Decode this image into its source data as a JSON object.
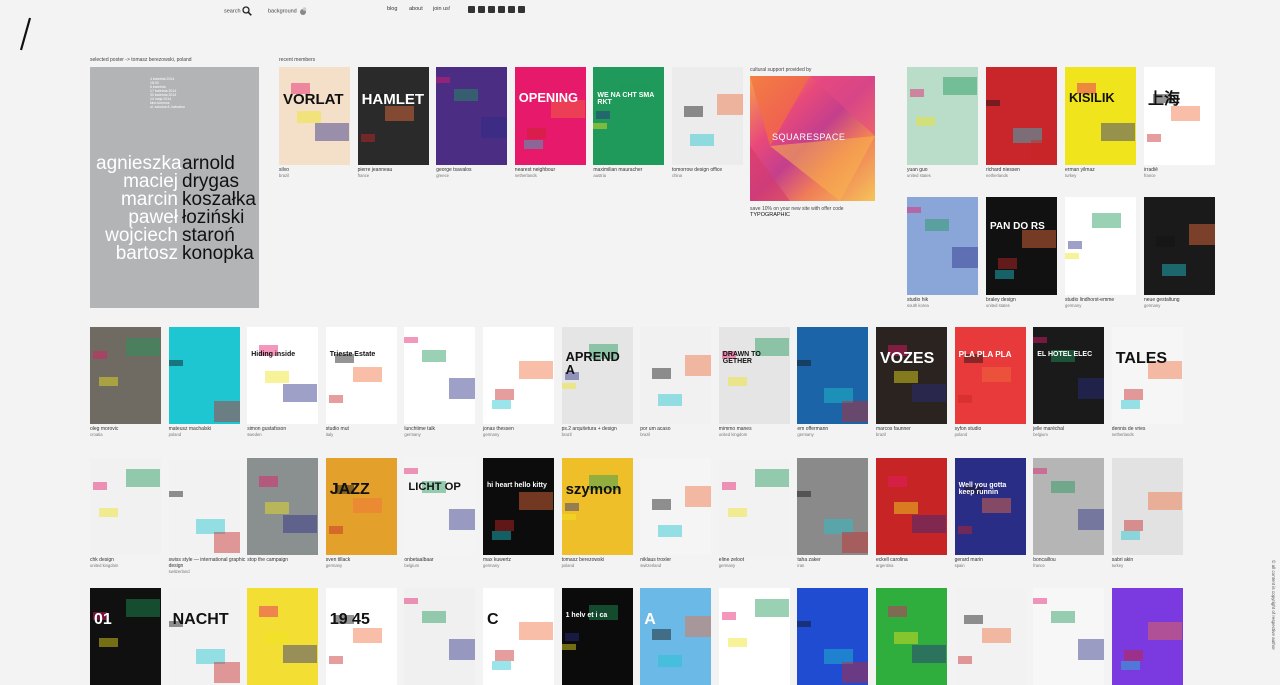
{
  "header": {
    "search_label": "search",
    "background_label": "background",
    "nav": [
      "blog",
      "about",
      "join us!"
    ],
    "social_icons": [
      "facebook-icon",
      "googleplus-icon",
      "tumblr-icon",
      "twitter-icon",
      "email-icon",
      "rss-icon"
    ]
  },
  "selected": {
    "label": "selected poster  -> tomasz berezowski, poland",
    "poster_small_lines": [
      "4 kwietnia 2014",
      "18:00",
      "6 kwietnia",
      "17 kwietnia 2014",
      "30 kwietnia 2014",
      "14 maja 2014",
      "kino kosmos",
      "ul. szkolna 8, katowice"
    ],
    "names_left": [
      "agnieszka",
      "maciej",
      "marcin",
      "paweł",
      "wojciech",
      "bartosz"
    ],
    "names_right": [
      "arnold",
      "drygas",
      "koszałka",
      "łoziński",
      "staroń",
      "konopka"
    ]
  },
  "recent_members_label": "recent members",
  "recent": [
    {
      "name": "silvo",
      "country": "brazil",
      "poster_text": "VORLAT"
    },
    {
      "name": "pierre jeanneau",
      "country": "france",
      "poster_text": "HAMLET"
    },
    {
      "name": "george tsavalos",
      "country": "greece",
      "poster_text": ""
    },
    {
      "name": "nearest neighbour",
      "country": "netherlands",
      "poster_text": "OPENING"
    },
    {
      "name": "maximilian mauracher",
      "country": "austria",
      "poster_text": "WE NA CHT SMA RKT"
    },
    {
      "name": "tomorrow design office",
      "country": "china",
      "poster_text": ""
    }
  ],
  "cultural": {
    "label": "cultural support provided by",
    "brand": "SQUARESPACE",
    "offer": "save 10% on your new site with offer code",
    "code": "TYPOGRAPHIC"
  },
  "side": [
    {
      "name": "yuan guo",
      "country": "united states",
      "poster_text": ""
    },
    {
      "name": "richard niessen",
      "country": "netherlands",
      "poster_text": ""
    },
    {
      "name": "erman yilmaz",
      "country": "turkey",
      "poster_text": "KISILIK"
    },
    {
      "name": "irradiē",
      "country": "france",
      "poster_text": "上海"
    },
    {
      "name": "studio hik",
      "country": "south korea",
      "poster_text": ""
    },
    {
      "name": "braley design",
      "country": "united states",
      "poster_text": "PAN DO RS"
    },
    {
      "name": "studio lindhorst-emme",
      "country": "germany",
      "poster_text": ""
    },
    {
      "name": "neue gestaltung",
      "country": "germany",
      "poster_text": ""
    }
  ],
  "row1": [
    {
      "name": "oleg morovic",
      "country": "croatia",
      "poster_text": ""
    },
    {
      "name": "mateusz machalski",
      "country": "poland",
      "poster_text": ""
    },
    {
      "name": "simon gustafsson",
      "country": "sweden",
      "poster_text": "Hiding inside"
    },
    {
      "name": "studio mut",
      "country": "italy",
      "poster_text": "Trieste Estate"
    },
    {
      "name": "lunchtime talk",
      "country": "germany",
      "poster_text": ""
    },
    {
      "name": "jonas thessen",
      "country": "germany",
      "poster_text": ""
    },
    {
      "name": "ps.2 arquitetura + design",
      "country": "brazil",
      "poster_text": "APRENDA"
    },
    {
      "name": "por um acaso",
      "country": "brazil",
      "poster_text": ""
    },
    {
      "name": "mimmo manes",
      "country": "united kingdom",
      "poster_text": "DRAWN TO GETHER"
    },
    {
      "name": "em offermann",
      "country": "germany",
      "poster_text": ""
    },
    {
      "name": "marcos faunner",
      "country": "brazil",
      "poster_text": "VOZES"
    },
    {
      "name": "syfon studio",
      "country": "poland",
      "poster_text": "PLA PLA PLA"
    },
    {
      "name": "jelle maréchal",
      "country": "belgium",
      "poster_text": "EL HOTEL ELEC"
    },
    {
      "name": "dennis de vries",
      "country": "netherlands",
      "poster_text": "TALES"
    }
  ],
  "row2": [
    {
      "name": "chk design",
      "country": "united kingdom",
      "poster_text": ""
    },
    {
      "name": "swiss style — international graphic design",
      "country": "switzerland",
      "poster_text": ""
    },
    {
      "name": "stop the campaign",
      "country": "",
      "poster_text": ""
    },
    {
      "name": "sven tillack",
      "country": "germany",
      "poster_text": "JAZZ"
    },
    {
      "name": "onbetaalbaar",
      "country": "belgium",
      "poster_text": "LICHT OP"
    },
    {
      "name": "max kuwertz",
      "country": "germany",
      "poster_text": "hi heart hello kitty"
    },
    {
      "name": "tomasz berezowski",
      "country": "poland",
      "poster_text": "szymon"
    },
    {
      "name": "niklaus troxler",
      "country": "switzerland",
      "poster_text": ""
    },
    {
      "name": "eline zeloot",
      "country": "germany",
      "poster_text": ""
    },
    {
      "name": "taha zaker",
      "country": "iran",
      "poster_text": ""
    },
    {
      "name": "eckell carolina",
      "country": "argentina",
      "poster_text": ""
    },
    {
      "name": "gerard marin",
      "country": "spain",
      "poster_text": "Well you gotta keep runnin"
    },
    {
      "name": "boncaillou",
      "country": "france",
      "poster_text": ""
    },
    {
      "name": "sabri akin",
      "country": "turkey",
      "poster_text": ""
    }
  ],
  "row3": [
    {
      "poster_text": "01"
    },
    {
      "poster_text": "NACHT"
    },
    {
      "poster_text": ""
    },
    {
      "poster_text": "19 45"
    },
    {
      "poster_text": ""
    },
    {
      "poster_text": "C"
    },
    {
      "poster_text": "1 helv et i ca"
    },
    {
      "poster_text": "A"
    },
    {
      "poster_text": ""
    },
    {
      "poster_text": ""
    },
    {
      "poster_text": ""
    },
    {
      "poster_text": ""
    },
    {
      "poster_text": ""
    },
    {
      "poster_text": ""
    }
  ],
  "copyright": "© all content is copyright of respective author",
  "colors": {
    "background": "#f3f3f3",
    "recent": [
      "#f4e0c8",
      "#2a2a2a",
      "#4b2d84",
      "#e7196a",
      "#1f9a5a",
      "#ececec"
    ],
    "side": [
      "#b9ddc9",
      "#c9262c",
      "#f0e51c",
      "#ffffff",
      "#8aa6d9",
      "#111111",
      "#ffffff",
      "#1a1a1a"
    ],
    "row1": [
      "#6f6a62",
      "#1ec6d1",
      "#ffffff",
      "#ffffff",
      "#ffffff",
      "#ffffff",
      "#e5e5e5",
      "#f1f1f1",
      "#e5e5e5",
      "#1c64a8",
      "#2b2320",
      "#e83a3a",
      "#1a1a1a",
      "#f6f6f6"
    ],
    "row2": [
      "#f1f1f1",
      "#f2f2f2",
      "#8a8f8f",
      "#e3a02a",
      "#f4f4f4",
      "#0c0c0c",
      "#eebf28",
      "#f5f5f5",
      "#f2f2f2",
      "#8a8a8a",
      "#c72525",
      "#2a2d86",
      "#b5b5b5",
      "#e2e2e2"
    ],
    "row3": [
      "#101010",
      "#f2f2f2",
      "#f3de33",
      "#ffffff",
      "#f0f0f0",
      "#ffffff",
      "#0b0b0b",
      "#6bb9e7",
      "#ffffff",
      "#1f4cd1",
      "#2fae3e",
      "#f2f2f2",
      "#f7f7f7",
      "#7a3ae0"
    ]
  }
}
